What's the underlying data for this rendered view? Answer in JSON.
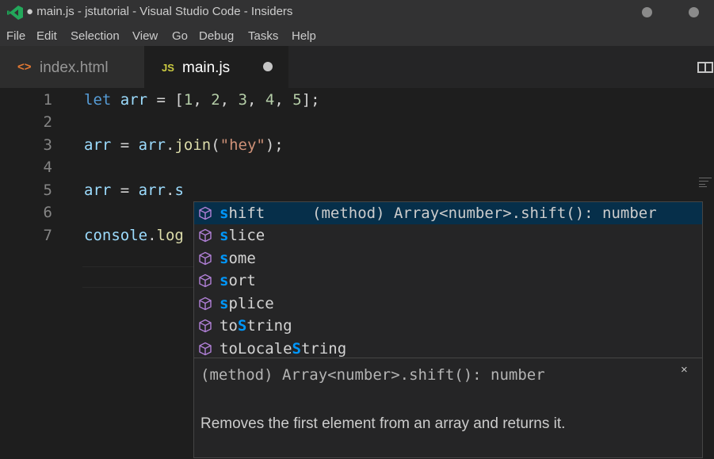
{
  "window": {
    "title": "● main.js - jstutorial - Visual Studio Code - Insiders"
  },
  "menu": [
    "File",
    "Edit",
    "Selection",
    "View",
    "Go",
    "Debug",
    "Tasks",
    "Help"
  ],
  "tabs": [
    {
      "icon": "<>",
      "label": "index.html",
      "active": false
    },
    {
      "icon": "JS",
      "label": "main.js",
      "active": true,
      "dirty": true
    }
  ],
  "editor": {
    "line_numbers": [
      "1",
      "2",
      "3",
      "4",
      "5",
      "6",
      "7"
    ],
    "lines": {
      "l1": {
        "kw": "let",
        "sp1": " ",
        "var": "arr",
        "op1": " = [",
        "n1": "1",
        "c1": ", ",
        "n2": "2",
        "c2": ", ",
        "n3": "3",
        "c3": ", ",
        "n4": "4",
        "c4": ", ",
        "n5": "5",
        "end": "];"
      },
      "l3": {
        "v1": "arr",
        "op": " = ",
        "v2": "arr",
        "dot": ".",
        "fn": "join",
        "p1": "(",
        "str": "\"hey\"",
        "p2": ");"
      },
      "l5": {
        "v1": "arr",
        "op": " = ",
        "v2": "arr",
        "dot": ".",
        "typed": "s"
      },
      "l7": {
        "v1": "console",
        "dot": ".",
        "fn": "log"
      }
    }
  },
  "suggest": {
    "items": [
      {
        "hl": "s",
        "rest": "hift",
        "pre": ""
      },
      {
        "hl": "s",
        "rest": "lice",
        "pre": ""
      },
      {
        "hl": "s",
        "rest": "ome",
        "pre": ""
      },
      {
        "hl": "s",
        "rest": "ort",
        "pre": ""
      },
      {
        "hl": "s",
        "rest": "plice",
        "pre": ""
      },
      {
        "pre": "to",
        "hl": "S",
        "rest": "tring"
      },
      {
        "pre": "toLocale",
        "hl": "S",
        "rest": "tring"
      }
    ],
    "selected_detail": "(method) Array<number>.shift(): number"
  },
  "details": {
    "signature": "(method) Array<number>.shift(): number",
    "doc": "Removes the first element from an array and returns it.",
    "close": "×"
  },
  "colors": {
    "accent": "#0097fb",
    "method_icon": "#b180d7",
    "selection": "#062f4a"
  }
}
